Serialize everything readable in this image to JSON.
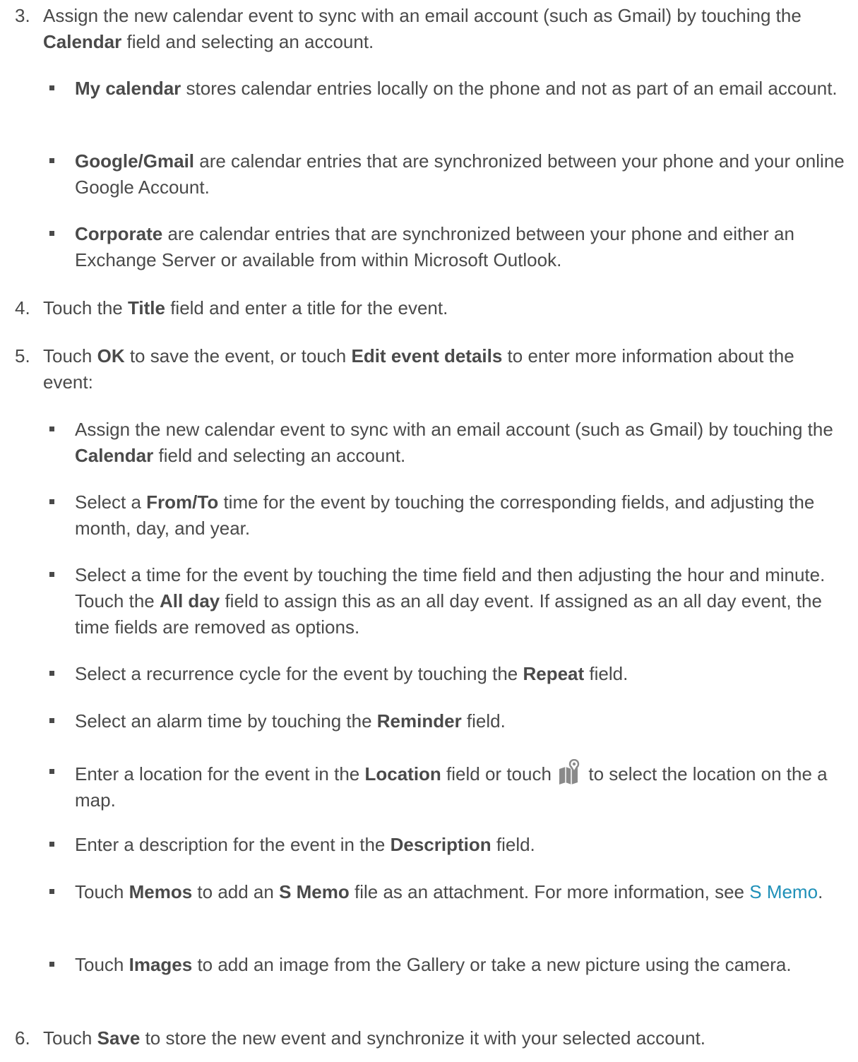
{
  "step3": {
    "num": "3.",
    "t1": "Assign the new calendar event to sync with an email account (such as Gmail) by touching the ",
    "b1": "Calendar",
    "t2": " field and selecting an account.",
    "bullets": [
      {
        "b": "My calendar",
        "t": " stores calendar entries locally on the phone and not as part of an email account."
      },
      {
        "b": "Google/Gmail",
        "t": " are calendar entries that are synchronized between your phone and your online Google Account."
      },
      {
        "b": "Corporate",
        "t": " are calendar entries that are synchronized between your phone and either an Exchange Server or available from within Microsoft Outlook."
      }
    ]
  },
  "step4": {
    "num": "4.",
    "t1": "Touch the ",
    "b1": "Title",
    "t2": " field and enter a title for the event."
  },
  "step5": {
    "num": "5.",
    "t1": "Touch ",
    "b1": "OK",
    "t2": " to save the event, or touch ",
    "b2": "Edit event details",
    "t3": " to enter more information about the event:",
    "bullets": {
      "calendar": {
        "t1": "Assign the new calendar event to sync with an email account (such as Gmail) by touching the ",
        "b1": "Calendar",
        "t2": " field and selecting an account."
      },
      "fromto": {
        "t1": "Select a ",
        "b1": "From/To",
        "t2": " time for the event by touching the corresponding fields, and adjusting the month, day, and year."
      },
      "time": {
        "t1": "Select a time for the event by touching the time field and then adjusting the hour and minute. Touch the ",
        "b1": "All day",
        "t2": " field to assign this as an all day event. If assigned as an all day event, the time fields are removed as options."
      },
      "repeat": {
        "t1": "Select a recurrence cycle for the event by touching the ",
        "b1": "Repeat",
        "t2": " field."
      },
      "reminder": {
        "t1": "Select an alarm time by touching the ",
        "b1": "Reminder",
        "t2": " field."
      },
      "location": {
        "t1": "Enter a location for the event in the ",
        "b1": "Location",
        "t2": " field or touch ",
        "t3": " to select the location on the a map.",
        "icon": "map-pin-icon"
      },
      "description": {
        "t1": "Enter a description for the event in the ",
        "b1": "Description",
        "t2": " field."
      },
      "memos": {
        "t1": "Touch ",
        "b1": "Memos",
        "t2": " to add an ",
        "b2": "S Memo",
        "t3": " file as an attachment. For more information, see ",
        "link": "S Memo",
        "t4": "."
      },
      "images": {
        "t1": "Touch ",
        "b1": "Images",
        "t2": " to add an image from the Gallery or take a new picture using the camera."
      }
    }
  },
  "step6": {
    "num": "6.",
    "t1": "Touch ",
    "b1": "Save",
    "t2": " to store the new event and synchronize it with your selected account."
  },
  "colors": {
    "text": "#4a4a4a",
    "link": "#1f90b8",
    "bullet": "#4a4a4a"
  }
}
